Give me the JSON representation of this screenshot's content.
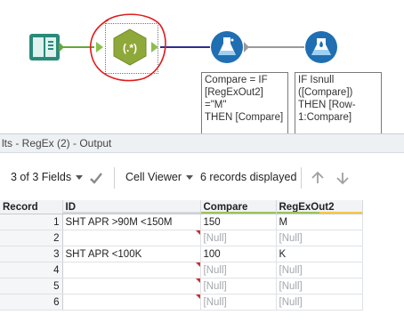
{
  "workflow": {
    "tools": [
      {
        "name": "input-tool",
        "icon": "book-input-icon"
      },
      {
        "name": "regex-tool",
        "icon": "regex-hexagon-icon",
        "glyph": "(.*)"
      },
      {
        "name": "formula-tool-1",
        "icon": "flask-formula-icon"
      },
      {
        "name": "formula-tool-2",
        "icon": "flask-formula-icon"
      }
    ],
    "annotations": [
      "Compare = IF\n[RegExOut2]\n=\"M\"\nTHEN [Compare]",
      "IF Isnull\n([Compare])\nTHEN [Row-\n1:Compare]"
    ]
  },
  "results": {
    "title": "lts - RegEx (2) - Output",
    "fields_label": "3 of 3 Fields",
    "viewer_label": "Cell Viewer",
    "records_label": "6 records displayed",
    "columns": [
      "Record",
      "ID",
      "Compare",
      "RegExOut2"
    ],
    "rows": [
      {
        "record": "1",
        "id": "SHT APR >90M <150M",
        "compare": "150",
        "regex": "M"
      },
      {
        "record": "2",
        "id": "",
        "compare": "[Null]",
        "regex": "[Null]"
      },
      {
        "record": "3",
        "id": "SHT APR <100K",
        "compare": "100",
        "regex": "K"
      },
      {
        "record": "4",
        "id": "",
        "compare": "[Null]",
        "regex": "[Null]"
      },
      {
        "record": "5",
        "id": "",
        "compare": "[Null]",
        "regex": "[Null]"
      },
      {
        "record": "6",
        "id": "",
        "compare": "[Null]",
        "regex": "[Null]"
      }
    ]
  },
  "colors": {
    "accent_blue": "#1f6fb2",
    "regex_green": "#8fa83a",
    "input_teal": "#2a8a7a",
    "null_text": "#a4a8ad",
    "marker_red": "#d12a2a"
  }
}
